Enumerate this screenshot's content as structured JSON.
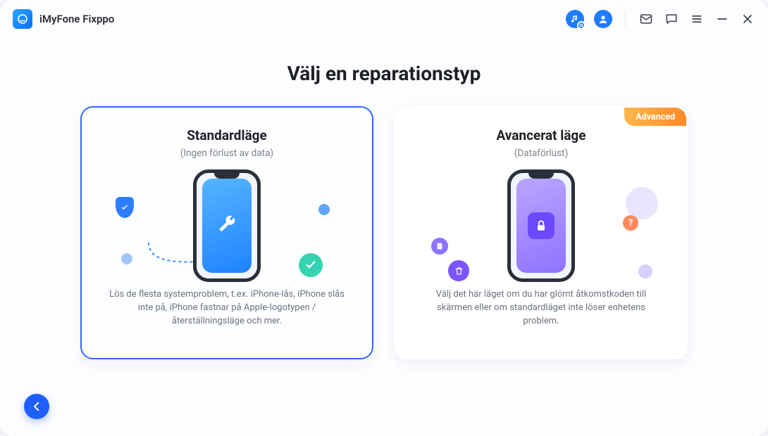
{
  "app": {
    "title": "iMyFone Fixppo"
  },
  "titlebar": {
    "icons": {
      "music": "music-search-icon",
      "account": "account-icon",
      "mail": "mail-icon",
      "feedback": "feedback-icon",
      "menu": "menu-icon",
      "minimize": "minimize-icon",
      "close": "close-icon"
    }
  },
  "heading": "Välj en reparationstyp",
  "cards": {
    "standard": {
      "title": "Standardläge",
      "subtitle": "(Ingen förlust av data)",
      "description": "Lös de flesta systemproblem, t.ex. iPhone-lås, iPhone slås inte på, iPhone fastnar på Apple-logotypen / återställningsläge och mer."
    },
    "advanced": {
      "badge": "Advanced",
      "title": "Avancerat läge",
      "subtitle": "(Dataförlust)",
      "description": "Välj det här läget om du har glömt åtkomstkoden till skärmen eller om standardläget inte löser enhetens problem.",
      "q": "?"
    }
  },
  "back": {
    "label": "back"
  }
}
